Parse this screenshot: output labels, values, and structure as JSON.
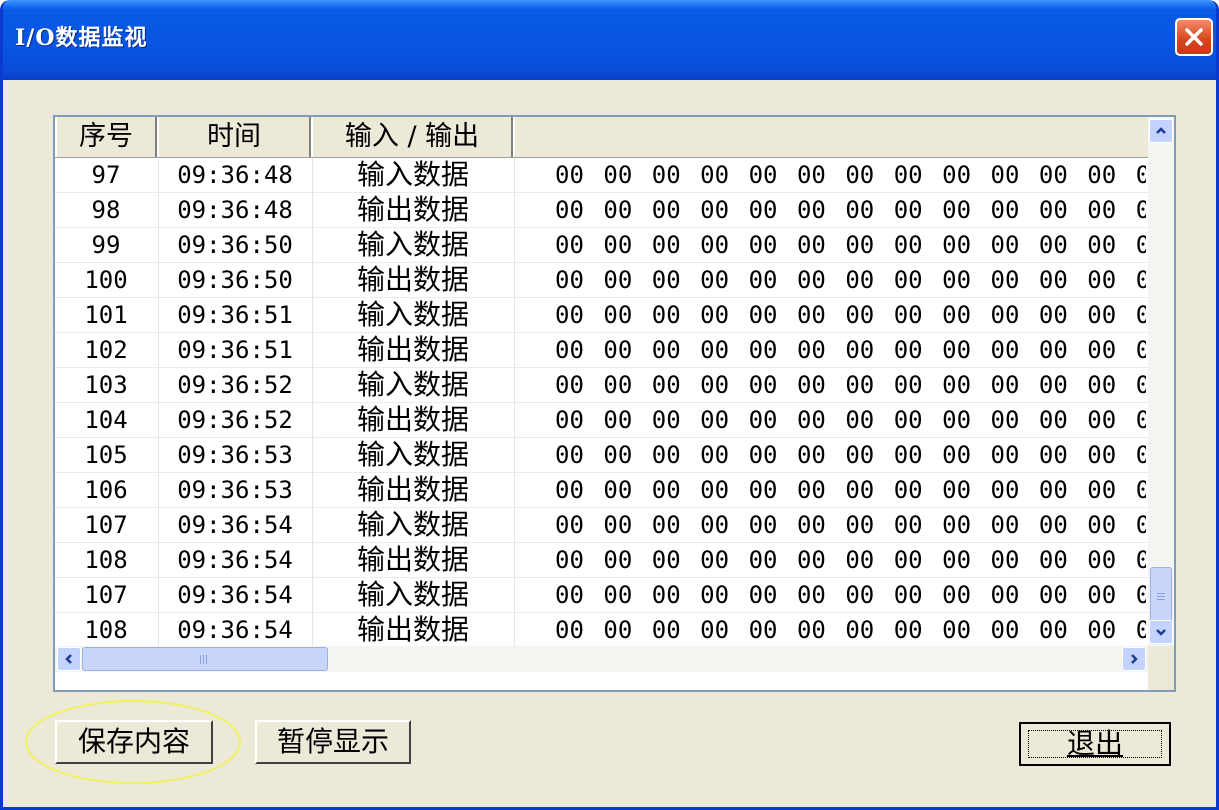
{
  "window": {
    "title": "I/O数据监视"
  },
  "table": {
    "columns": [
      "序号",
      "时间",
      "输入 / 输出"
    ],
    "data_byte": "00",
    "rows": [
      {
        "idx": "97",
        "time": "09:36:48",
        "io": "输入数据"
      },
      {
        "idx": "98",
        "time": "09:36:48",
        "io": "输出数据"
      },
      {
        "idx": "99",
        "time": "09:36:50",
        "io": "输入数据"
      },
      {
        "idx": "100",
        "time": "09:36:50",
        "io": "输出数据"
      },
      {
        "idx": "101",
        "time": "09:36:51",
        "io": "输入数据"
      },
      {
        "idx": "102",
        "time": "09:36:51",
        "io": "输出数据"
      },
      {
        "idx": "103",
        "time": "09:36:52",
        "io": "输入数据"
      },
      {
        "idx": "104",
        "time": "09:36:52",
        "io": "输出数据"
      },
      {
        "idx": "105",
        "time": "09:36:53",
        "io": "输入数据"
      },
      {
        "idx": "106",
        "time": "09:36:53",
        "io": "输出数据"
      },
      {
        "idx": "107",
        "time": "09:36:54",
        "io": "输入数据"
      },
      {
        "idx": "108",
        "time": "09:36:54",
        "io": "输出数据"
      },
      {
        "idx": "107",
        "time": "09:36:54",
        "io": "输入数据"
      },
      {
        "idx": "108",
        "time": "09:36:54",
        "io": "输出数据"
      }
    ]
  },
  "buttons": {
    "save": "保存内容",
    "pause": "暂停显示",
    "exit": "退出"
  },
  "colors": {
    "title_bar": "#0755e2",
    "close_button": "#d8441b",
    "highlight_ellipse": "#f2f25a",
    "dialog_face": "#ece9d8"
  },
  "icons": {
    "close": "close-icon",
    "scroll_up": "chevron-up-icon",
    "scroll_down": "chevron-down-icon",
    "scroll_left": "chevron-left-icon",
    "scroll_right": "chevron-right-icon"
  }
}
